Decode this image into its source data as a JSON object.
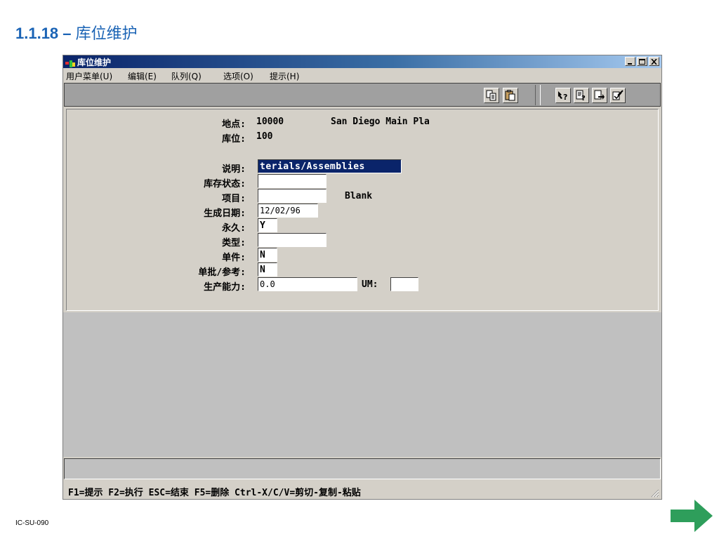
{
  "slide": {
    "title_number": "1.1.18 –",
    "title_text": "库位维护",
    "footer_code": "IC-SU-090",
    "accent_color": "#1a63b5",
    "next_arrow_color": "#2e9e5b",
    "next_icon": "right-arrow-icon"
  },
  "window": {
    "title": "库位维护",
    "app_icon": "app-icon",
    "controls": [
      "minimize-icon",
      "maximize-icon",
      "close-icon"
    ]
  },
  "menu": {
    "items": [
      {
        "label": "用户菜单(U)"
      },
      {
        "label": "编辑(E)"
      },
      {
        "label": "队列(Q)"
      },
      {
        "label": "选项(O)"
      },
      {
        "label": "提示(H)"
      }
    ]
  },
  "toolbar": {
    "buttons": [
      {
        "icon": "copy-icon"
      },
      {
        "icon": "paste-icon"
      },
      {
        "icon": "field-help-icon"
      },
      {
        "icon": "help-icon"
      },
      {
        "icon": "go-icon"
      },
      {
        "icon": "end-icon"
      }
    ]
  },
  "form": {
    "site_label": "地点:",
    "site_value": "10000",
    "site_name": "San Diego Main Pla",
    "location_label": "库位:",
    "location_value": "100",
    "description_label": "说明:",
    "description_value": "terials/Assemblies",
    "inv_status_label": "库存状态:",
    "inv_status_value": "",
    "project_label": "项目:",
    "project_value": "",
    "project_note": "Blank",
    "created_label": "生成日期:",
    "created_value": "12/02/96",
    "permanent_label": "永久:",
    "permanent_value": "Y",
    "type_label": "类型:",
    "type_value": "",
    "single_item_label": "单件:",
    "single_item_value": "N",
    "single_lot_label": "单批/参考:",
    "single_lot_value": "N",
    "capacity_label": "生产能力:",
    "capacity_value": "0.0",
    "um_label": "UM:",
    "um_value": ""
  },
  "status": {
    "hint": "F1=提示 F2=执行 ESC=结束 F5=删除 Ctrl-X/C/V=剪切-复制-粘贴"
  }
}
